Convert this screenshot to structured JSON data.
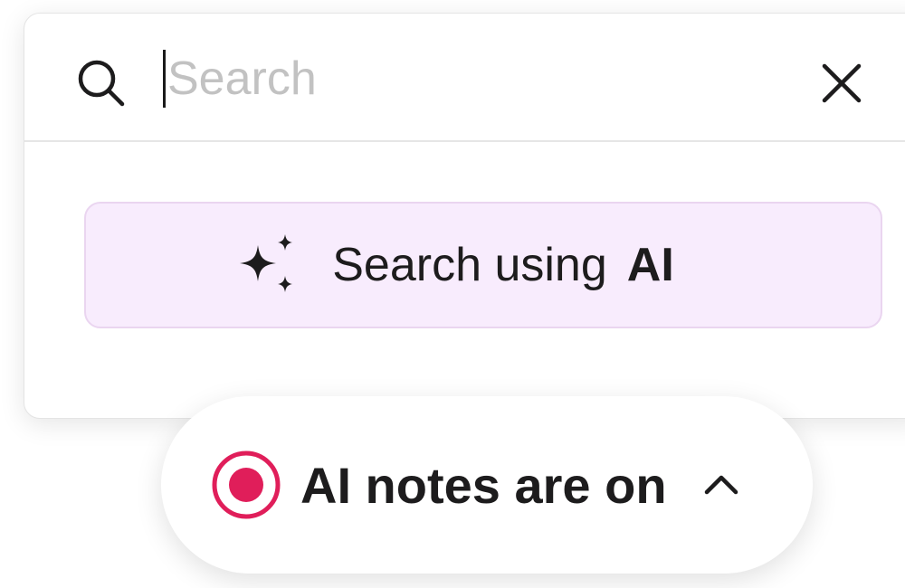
{
  "search": {
    "placeholder": "Search",
    "value": "",
    "search_icon": "search-icon",
    "close_icon": "close-icon"
  },
  "ai_search": {
    "icon": "sparkle-icon",
    "label": "Search using",
    "label_strong": "AI",
    "background": "#f8ecfd"
  },
  "notes_pill": {
    "icon": "record-icon",
    "label": "AI notes are on",
    "chevron": "chevron-up-icon",
    "record_color": "#e01e5a"
  }
}
